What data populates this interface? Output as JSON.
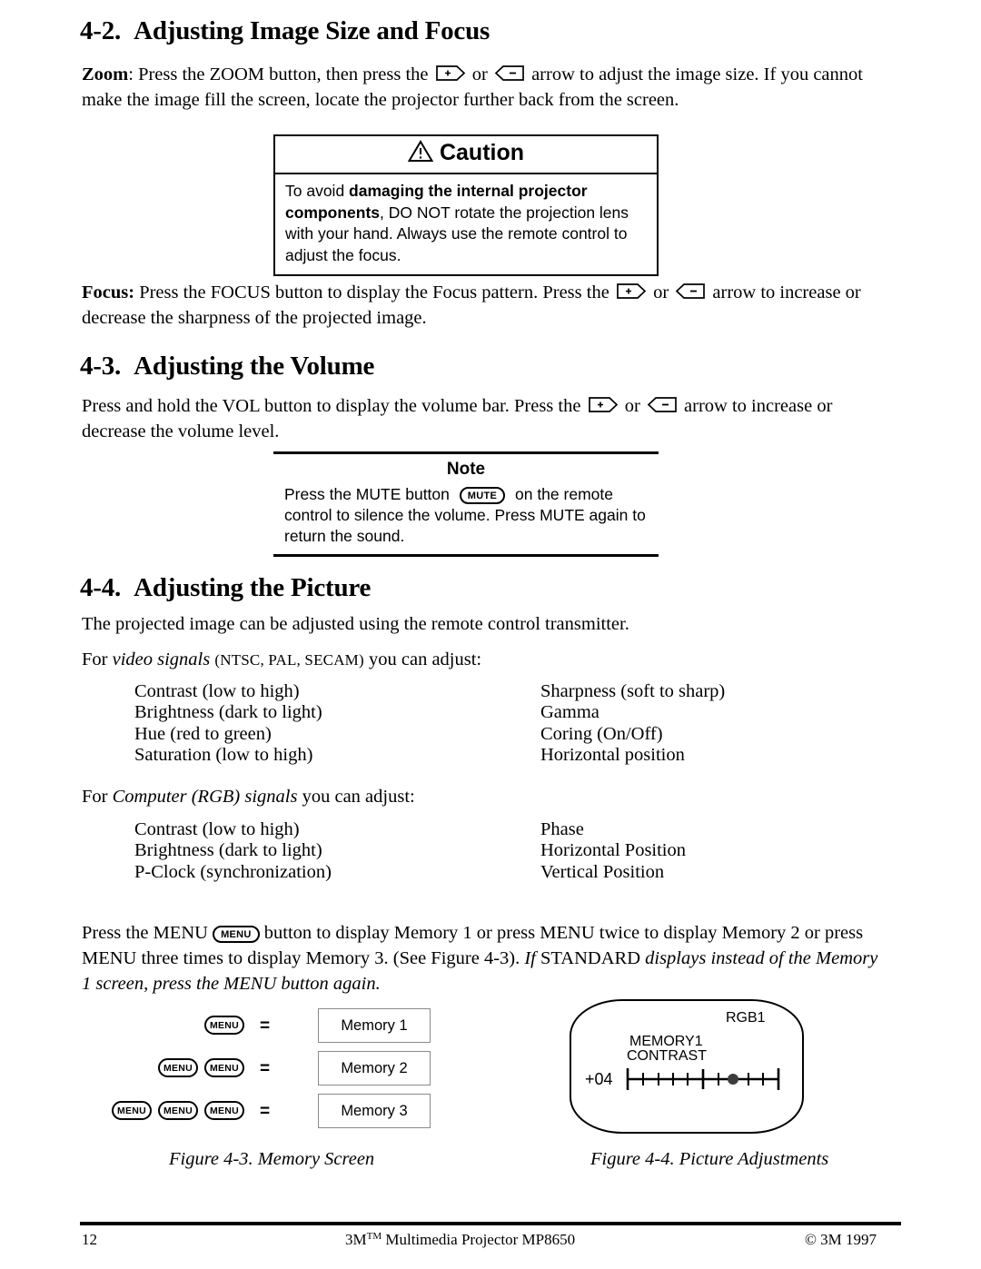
{
  "document": {
    "page_number": "12",
    "footer_center_pre": "3M",
    "footer_center_tm": "TM",
    "footer_center_post": " Multimedia Projector MP8650",
    "footer_right": "© 3M 1997"
  },
  "sections": {
    "s42": {
      "number": "4-2.",
      "title": "Adjusting Image Size and Focus",
      "zoom_label": "Zoom",
      "zoom_p1": ": Press the ZOOM button, then press the ",
      "zoom_or": " or ",
      "zoom_p2": " arrow to adjust the image size.  If you cannot make the image fill the screen, locate the projector further back from the screen.",
      "focus_label": "Focus:",
      "focus_p1": " Press the FOCUS button to display the Focus pattern.  Press the ",
      "focus_or": " or ",
      "focus_p2": " arrow to increase or decrease the sharpness of the projected image."
    },
    "s43": {
      "number": "4-3.",
      "title": "Adjusting the Volume",
      "vol_p1": "Press and hold the VOL button to display the volume bar.  Press the ",
      "vol_or": " or ",
      "vol_p2": " arrow to increase or decrease the volume level."
    },
    "s44": {
      "number": "4-4.",
      "title": "Adjusting the Picture",
      "intro": "The projected image can be adjusted using the remote control transmitter.",
      "video_lead_1": "For ",
      "video_lead_italic": "video signals",
      "video_lead_2": " ",
      "video_lead_smallcaps": "(NTSC, PAL, SECAM)",
      "video_lead_3": " you can adjust:",
      "rgb_lead_1": "For ",
      "rgb_lead_italic": "Computer (RGB) signals",
      "rgb_lead_2": " you can adjust:",
      "menu_p1": "Press the MENU ",
      "menu_key": "MENU",
      "menu_p2": " button to display Memory 1 or press MENU twice to display Memory 2 or press MENU three times to display Memory 3.  (See Figure 4-3).  ",
      "menu_italic_1": "If",
      "menu_mid": "  STANDARD ",
      "menu_italic_2": "displays instead of the Memory 1 screen, press the MENU button again."
    }
  },
  "caution": {
    "icon": "warning-triangle-icon",
    "heading": "Caution",
    "body_1": "To avoid ",
    "body_bold_1": "damaging the internal projector components",
    "body_2": ", DO NOT rotate the projection lens with your hand.  Always use the remote control to adjust the focus."
  },
  "note": {
    "heading": "Note",
    "body_1": "Press the MUTE button ",
    "mute_key": "MUTE",
    "body_2": " on the remote control to silence the volume. Press MUTE again to return the sound."
  },
  "video_adjustments": {
    "left": [
      "Contrast (low to high)",
      "Brightness (dark to light)",
      "Hue (red to green)",
      "Saturation (low to high)"
    ],
    "right": [
      "Sharpness (soft to sharp)",
      "Gamma",
      "Coring (On/Off)",
      "Horizontal position"
    ]
  },
  "rgb_adjustments": {
    "left": [
      "Contrast (low to high)",
      "Brightness (dark to light)",
      "P-Clock (synchronization)"
    ],
    "right": [
      "Phase",
      "Horizontal Position",
      "Vertical Position"
    ]
  },
  "figure_4_3": {
    "caption": "Figure 4-3.  Memory Screen",
    "equals": "=",
    "key_label": "MENU",
    "rows": [
      {
        "presses": 1,
        "result": "Memory 1"
      },
      {
        "presses": 2,
        "result": "Memory 2"
      },
      {
        "presses": 3,
        "result": "Memory 3"
      }
    ]
  },
  "figure_4_4": {
    "caption": "Figure 4-4.  Picture Adjustments",
    "source_label": "RGB1",
    "memory_label": "MEMORY1",
    "parameter_label": "CONTRAST",
    "value": "+04"
  },
  "chart_data": {
    "type": "bar",
    "title": "CONTRAST",
    "categories": [
      "CONTRAST"
    ],
    "values": [
      4
    ],
    "xlabel": "",
    "ylabel": "",
    "ylim": [
      -8,
      8
    ]
  },
  "icons": {
    "plus_key": "plus-arrow-key-icon",
    "minus_key": "minus-arrow-key-icon",
    "warning": "warning-triangle-icon"
  }
}
